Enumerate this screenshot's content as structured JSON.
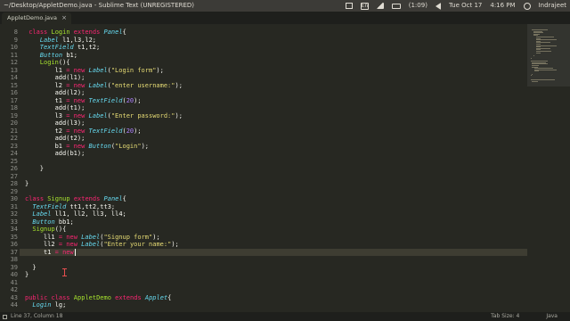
{
  "window": {
    "title": "~/Desktop/AppletDemo.java - Sublime Text (UNREGISTERED)"
  },
  "tray": {
    "battery": "(1:09)",
    "date": "Tue Oct 17",
    "time": "4:16 PM",
    "user": "Indrajeet",
    "keyboard": "En"
  },
  "tabs": [
    {
      "label": "AppletDemo.java"
    }
  ],
  "status": {
    "position": "Line 37, Column 18",
    "tab_size": "Tab Size: 4",
    "syntax": "Java"
  },
  "editor": {
    "current_line": 37,
    "lines": [
      {
        "n": "8",
        "s": [
          [
            "kw",
            "class "
          ],
          [
            "cl",
            "Login "
          ],
          [
            "kw",
            "extends "
          ],
          [
            "ty",
            "Panel"
          ],
          [
            "",
            "{"
          ]
        ],
        "i": 1
      },
      {
        "n": "9",
        "s": [
          [
            "ty",
            "Label "
          ],
          [
            "",
            "l1,l3,l2;"
          ]
        ],
        "i": 4
      },
      {
        "n": "10",
        "s": [
          [
            "ty",
            "TextField "
          ],
          [
            "",
            "t1,t2;"
          ]
        ],
        "i": 4
      },
      {
        "n": "11",
        "s": [
          [
            "ty",
            "Button "
          ],
          [
            "",
            "b1;"
          ]
        ],
        "i": 4
      },
      {
        "n": "12",
        "s": [
          [
            "cl",
            "Login"
          ],
          [
            "",
            "(){"
          ]
        ],
        "i": 4
      },
      {
        "n": "13",
        "s": [
          [
            "",
            "l1 "
          ],
          [
            "kw",
            "= new "
          ],
          [
            "ty",
            "Label"
          ],
          [
            "",
            "("
          ],
          [
            "st",
            "\"Login form\""
          ],
          [
            "",
            ");"
          ]
        ],
        "i": 8
      },
      {
        "n": "14",
        "s": [
          [
            "",
            "add(l1);"
          ]
        ],
        "i": 8
      },
      {
        "n": "15",
        "s": [
          [
            "",
            "l2 "
          ],
          [
            "kw",
            "= new "
          ],
          [
            "ty",
            "Label"
          ],
          [
            "",
            "("
          ],
          [
            "st",
            "\"enter username:\""
          ],
          [
            "",
            ");"
          ]
        ],
        "i": 8
      },
      {
        "n": "16",
        "s": [
          [
            "",
            "add(l2);"
          ]
        ],
        "i": 8
      },
      {
        "n": "17",
        "s": [
          [
            "",
            "t1 "
          ],
          [
            "kw",
            "= new "
          ],
          [
            "ty",
            "TextField"
          ],
          [
            "",
            "("
          ],
          [
            "nm",
            "20"
          ],
          [
            "",
            ");"
          ]
        ],
        "i": 8
      },
      {
        "n": "18",
        "s": [
          [
            "",
            "add(t1);"
          ]
        ],
        "i": 8
      },
      {
        "n": "19",
        "s": [
          [
            "",
            "l3 "
          ],
          [
            "kw",
            "= new "
          ],
          [
            "ty",
            "Label"
          ],
          [
            "",
            "("
          ],
          [
            "st",
            "\"Enter password:\""
          ],
          [
            "",
            ");"
          ]
        ],
        "i": 8
      },
      {
        "n": "20",
        "s": [
          [
            "",
            "add(l3);"
          ]
        ],
        "i": 8
      },
      {
        "n": "21",
        "s": [
          [
            "",
            "t2 "
          ],
          [
            "kw",
            "= new "
          ],
          [
            "ty",
            "TextField"
          ],
          [
            "",
            "("
          ],
          [
            "nm",
            "20"
          ],
          [
            "",
            ");"
          ]
        ],
        "i": 8
      },
      {
        "n": "22",
        "s": [
          [
            "",
            "add(t2);"
          ]
        ],
        "i": 8
      },
      {
        "n": "23",
        "s": [
          [
            "",
            "b1 "
          ],
          [
            "kw",
            "= new "
          ],
          [
            "ty",
            "Button"
          ],
          [
            "",
            "("
          ],
          [
            "st",
            "\"Login\""
          ],
          [
            "",
            ");"
          ]
        ],
        "i": 8
      },
      {
        "n": "24",
        "s": [
          [
            "",
            "add(b1);"
          ]
        ],
        "i": 8
      },
      {
        "n": "25",
        "s": [],
        "i": 0
      },
      {
        "n": "26",
        "s": [
          [
            "",
            "}"
          ]
        ],
        "i": 4
      },
      {
        "n": "27",
        "s": [],
        "i": 0
      },
      {
        "n": "28",
        "s": [
          [
            "",
            "}"
          ]
        ],
        "i": 0
      },
      {
        "n": "29",
        "s": [],
        "i": 0
      },
      {
        "n": "30",
        "s": [
          [
            "kw",
            "class "
          ],
          [
            "cl",
            "Signup "
          ],
          [
            "kw",
            "extends "
          ],
          [
            "ty",
            "Panel"
          ],
          [
            "",
            "{"
          ]
        ],
        "i": 0
      },
      {
        "n": "31",
        "s": [
          [
            "ty",
            "TextField "
          ],
          [
            "",
            "tt1,tt2,tt3;"
          ]
        ],
        "i": 2
      },
      {
        "n": "32",
        "s": [
          [
            "ty",
            "Label "
          ],
          [
            "",
            "ll1, ll2, ll3, ll4;"
          ]
        ],
        "i": 2
      },
      {
        "n": "33",
        "s": [
          [
            "ty",
            "Button "
          ],
          [
            "",
            "bb1;"
          ]
        ],
        "i": 2
      },
      {
        "n": "34",
        "s": [
          [
            "cl",
            "Signup"
          ],
          [
            "",
            "(){"
          ]
        ],
        "i": 2
      },
      {
        "n": "35",
        "s": [
          [
            "",
            "ll1 "
          ],
          [
            "kw",
            "= new "
          ],
          [
            "ty",
            "Label"
          ],
          [
            "",
            "("
          ],
          [
            "st",
            "\"Signup form\""
          ],
          [
            "",
            ");"
          ]
        ],
        "i": 5
      },
      {
        "n": "36",
        "s": [
          [
            "",
            "ll2 "
          ],
          [
            "kw",
            "= new "
          ],
          [
            "ty",
            "Label"
          ],
          [
            "",
            "("
          ],
          [
            "st",
            "\"Enter your name:\""
          ],
          [
            "",
            ");"
          ]
        ],
        "i": 5
      },
      {
        "n": "37",
        "s": [
          [
            "",
            "t1 "
          ],
          [
            "kw",
            "= new"
          ]
        ],
        "i": 5
      },
      {
        "n": "38",
        "s": [],
        "i": 0
      },
      {
        "n": "39",
        "s": [
          [
            "",
            "}"
          ]
        ],
        "i": 2
      },
      {
        "n": "40",
        "s": [
          [
            "",
            "}"
          ]
        ],
        "i": 0
      },
      {
        "n": "41",
        "s": [],
        "i": 0
      },
      {
        "n": "42",
        "s": [],
        "i": 0
      },
      {
        "n": "43",
        "s": [
          [
            "kw",
            "public class "
          ],
          [
            "cl",
            "AppletDemo "
          ],
          [
            "kw",
            "extends "
          ],
          [
            "ty",
            "Applet"
          ],
          [
            "",
            "{"
          ]
        ],
        "i": 0
      },
      {
        "n": "44",
        "s": [
          [
            "ty",
            "Login "
          ],
          [
            "",
            "lg;"
          ]
        ],
        "i": 2
      }
    ]
  }
}
